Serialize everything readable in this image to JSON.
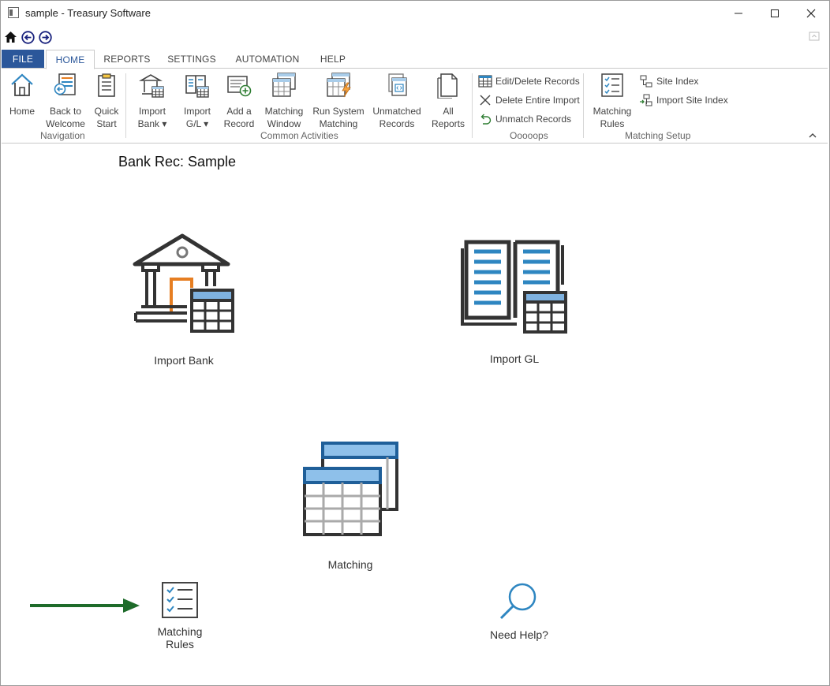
{
  "window": {
    "title": "sample - Treasury Software",
    "controls": [
      "minimize",
      "maximize",
      "close"
    ]
  },
  "quick_access": {
    "icons": [
      "home-icon",
      "back-icon",
      "forward-icon"
    ]
  },
  "tabs": [
    {
      "label": "FILE",
      "active": false
    },
    {
      "label": "HOME",
      "active": true
    },
    {
      "label": "REPORTS",
      "active": false
    },
    {
      "label": "SETTINGS",
      "active": false
    },
    {
      "label": "AUTOMATION",
      "active": false
    },
    {
      "label": "HELP",
      "active": false
    }
  ],
  "ribbon": {
    "navigation": {
      "group_label": "Navigation",
      "buttons": [
        {
          "label": "Home"
        },
        {
          "label": "Back to\nWelcome"
        },
        {
          "label": "Quick\nStart"
        }
      ]
    },
    "common": {
      "group_label": "Common Activities",
      "buttons": [
        {
          "label": "Import\nBank ▾"
        },
        {
          "label": "Import\nG/L ▾"
        },
        {
          "label": "Add a\nRecord"
        },
        {
          "label": "Matching\nWindow"
        },
        {
          "label": "Run System\nMatching"
        },
        {
          "label": "Unmatched\nRecords"
        },
        {
          "label": "All\nReports"
        }
      ]
    },
    "oops": {
      "group_label": "Ooooops",
      "buttons": [
        {
          "label": "Edit/Delete Records"
        },
        {
          "label": "Delete Entire Import"
        },
        {
          "label": "Unmatch Records"
        }
      ]
    },
    "setup": {
      "group_label": "Matching Setup",
      "matching_rules": "Matching\nRules",
      "site_index": "Site Index",
      "import_site_index": "Import Site Index"
    }
  },
  "main": {
    "title": "Bank Rec: Sample",
    "tiles": {
      "import_bank": "Import Bank",
      "import_gl": "Import GL",
      "matching": "Matching",
      "matching_rules": "Matching\nRules",
      "need_help": "Need Help?"
    }
  },
  "colors": {
    "accent": "#2b579a",
    "icon_blue": "#2e86c1",
    "icon_light_blue": "#a9cdea",
    "icon_dark": "#333333",
    "orange": "#e67e22",
    "arrow_green": "#1e6b2a"
  }
}
